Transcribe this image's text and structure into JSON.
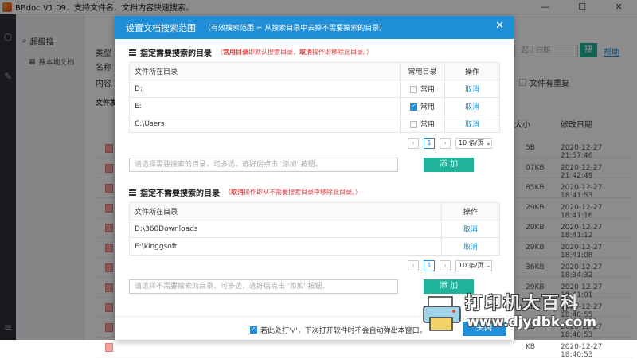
{
  "window": {
    "title": "BBdoc V1.09，支持文件名、文档内容快速搜索。",
    "minimize": "—",
    "maximize": "☐",
    "close": "✕"
  },
  "nav": {
    "super_search": "超级搜",
    "local_docs": "搜本地文档"
  },
  "main": {
    "type_label": "类型",
    "name_label": "名称",
    "content_label": "内容",
    "files_label": "文件发",
    "date_placeholder": "起止日期",
    "search_btn": "搜",
    "help_link": "帮助",
    "dup_label": "文件有重复",
    "size_header": "大小",
    "mod_header": "修改日期",
    "rows": [
      {
        "size": "5B",
        "date": "2020-12-27 21:57:46"
      },
      {
        "size": "07KB",
        "date": "2020-12-27 21:42:49"
      },
      {
        "size": "85KB",
        "date": "2020-12-27 18:41:53"
      },
      {
        "size": "29KB",
        "date": "2020-12-27 18:41:16"
      },
      {
        "size": "29KB",
        "date": "2020-12-27 18:41:12"
      },
      {
        "size": "29KB",
        "date": "2020-12-27 18:41:08"
      },
      {
        "size": "36KB",
        "date": "2020-12-27 18:34:32"
      },
      {
        "size": "29KB",
        "date": "2020-12-27 18:41:01"
      },
      {
        "size": "KB",
        "date": "2020-12-27 18:40:55"
      },
      {
        "size": "KB",
        "date": "2020-12-27 18:40:53"
      },
      {
        "size": "KB",
        "date": "2020-12-27 18:40:53"
      }
    ]
  },
  "modal": {
    "title": "设置文档搜索范围",
    "subtitle": "（有效搜索范围 = 从搜索目录中去掉不需要搜索的目录）",
    "close": "✕",
    "include": {
      "heading": "指定需要搜索的目录",
      "tip_open": "（",
      "tip_a": "常用目录",
      "tip_b": "即默认搜索目录，",
      "tip_c": "取消",
      "tip_d": "操作即移除此目录。）",
      "headers": [
        "文件所在目录",
        "常用目录",
        "操作"
      ],
      "rows": [
        {
          "dir": "D:",
          "common": "常用",
          "checked": false,
          "op": "取消"
        },
        {
          "dir": "E:",
          "common": "常用",
          "checked": true,
          "op": "取消"
        },
        {
          "dir": "C:\\Users",
          "common": "常用",
          "checked": false,
          "op": "取消"
        }
      ],
      "page": "1",
      "page_size": "10 条/页",
      "input_placeholder": "请选择需要搜索的目录，可多选，选好后点击 '添加' 按钮。",
      "add_btn": "添 加"
    },
    "exclude": {
      "heading": "指定不需要搜索的目录",
      "tip_open": "（",
      "tip_c": "取消",
      "tip_d": "操作即从不需要搜索目录中移除此目录。）",
      "headers": [
        "文件所在目录",
        "操作"
      ],
      "rows": [
        {
          "dir": "D:\\360Downloads",
          "op": "取消"
        },
        {
          "dir": "E:\\kinggsoft",
          "op": "取消"
        }
      ],
      "page": "1",
      "page_size": "10 条/页",
      "input_placeholder": "请选择不需要搜索的目录，可多选，选好后点击 '添加' 按钮。",
      "add_btn": "添 加"
    },
    "footer": {
      "checkbox_label": "若此处打'√'，下次打开软件时不会自动弹出本窗口。",
      "close_btn": "关闭"
    }
  },
  "watermark": {
    "text": "打印机大百科",
    "url": "www.djydbk.com"
  }
}
